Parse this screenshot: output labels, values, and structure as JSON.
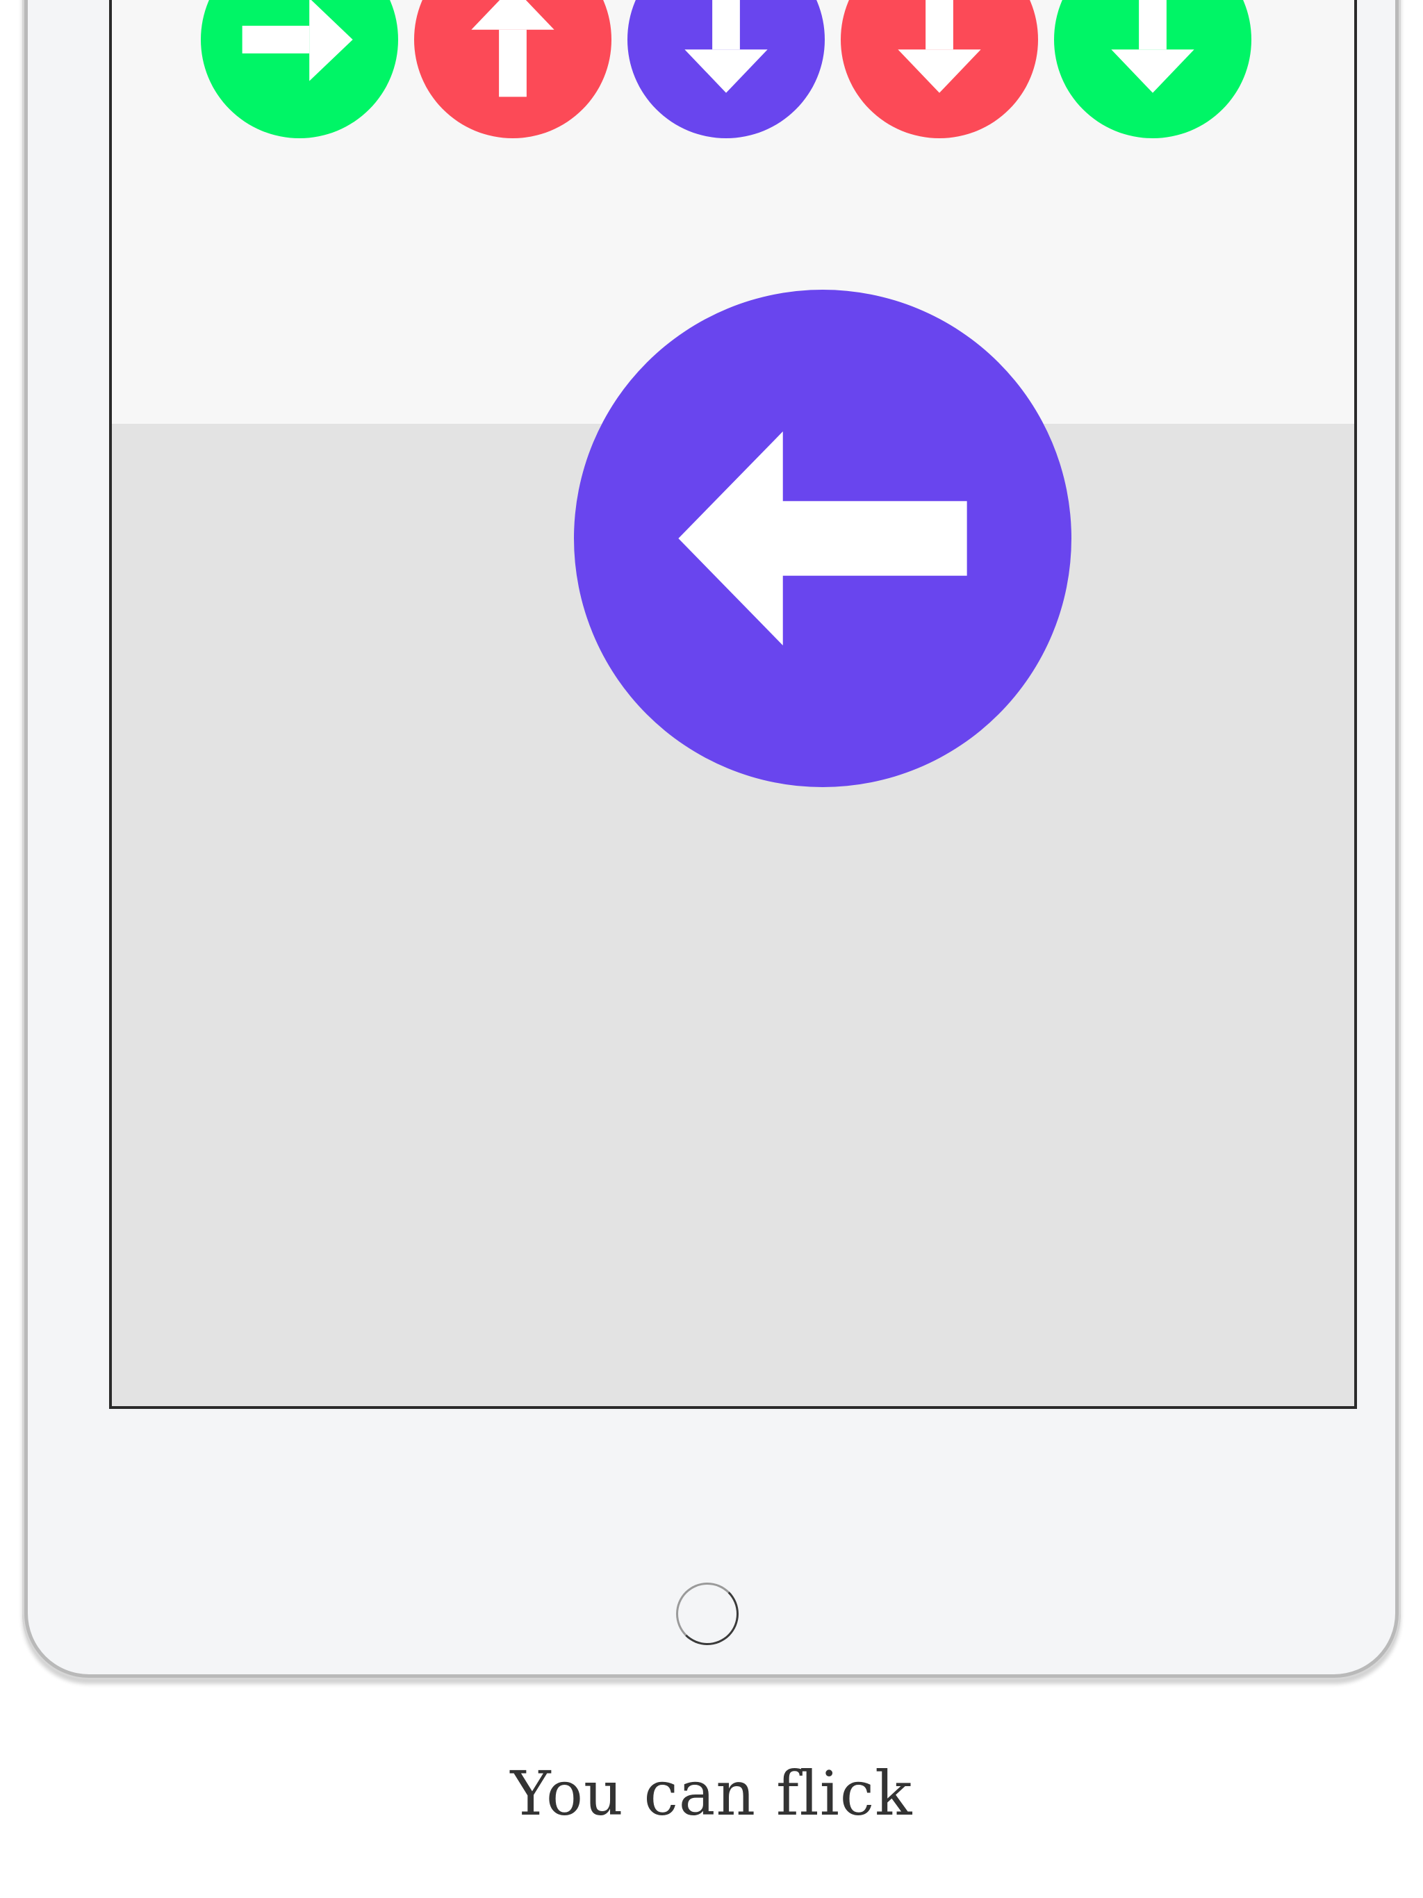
{
  "queue": [
    {
      "direction": "right",
      "color": "#00f566",
      "icon": "arrow-right-icon"
    },
    {
      "direction": "up",
      "color": "#fc4a57",
      "icon": "arrow-up-icon"
    },
    {
      "direction": "down",
      "color": "#6945ee",
      "icon": "arrow-down-icon"
    },
    {
      "direction": "down",
      "color": "#fc4a57",
      "icon": "arrow-down-icon"
    },
    {
      "direction": "down",
      "color": "#00f566",
      "icon": "arrow-down-icon"
    }
  ],
  "current": {
    "direction": "left",
    "color": "#6945ee",
    "icon": "arrow-left-icon"
  },
  "caption": "You can flick"
}
